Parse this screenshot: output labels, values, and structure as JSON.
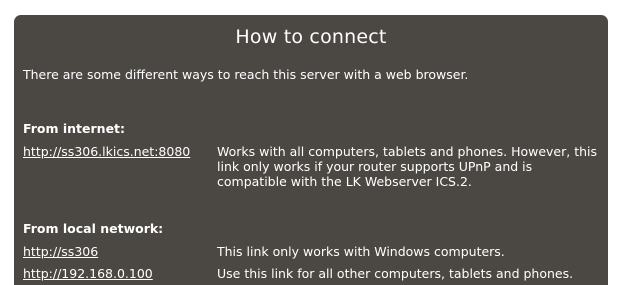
{
  "title": "How to connect",
  "intro": "There are some different ways to reach this server with a web browser.",
  "internet": {
    "heading": "From internet:",
    "link": "http://ss306.lkics.net:8080",
    "description": "Works with all computers, tablets and phones. However, this link only works if your router supports UPnP and is compatible with the LK Webserver ICS.2."
  },
  "local": {
    "heading": "From local network:",
    "entries": [
      {
        "link": "http://ss306",
        "description": "This link only works with Windows computers."
      },
      {
        "link": "http://192.168.0.100",
        "description": "Use this link for all other computers, tablets and phones."
      }
    ]
  },
  "colors": {
    "panel_background": "#4b4742",
    "text": "#ffffff",
    "page_background": "#ffffff"
  }
}
